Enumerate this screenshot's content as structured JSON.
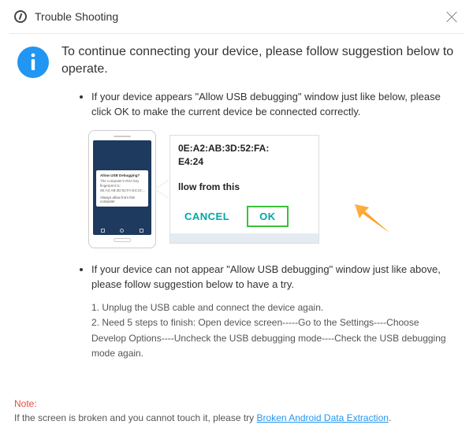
{
  "window": {
    "title": "Trouble Shooting"
  },
  "intro": "To continue connecting your device, please follow suggestion below to operate.",
  "bullet1": "If your device appears \"Allow USB debugging\" window just like below, please click OK to make the current device  be connected correctly.",
  "bullet2": "If your device can not appear \"Allow USB debugging\" window just like above, please follow suggestion below to have a try.",
  "steps": {
    "s1": "1. Unplug the USB cable and connect the device again.",
    "s2": "2. Need 5 steps to finish: Open device screen-----Go to the Settings----Choose Develop Options----Uncheck the USB debugging mode----Check the USB debugging mode again."
  },
  "phone_dialog": {
    "title": "Allow USB Debugging?",
    "body": "The computer's RSA key fingerprint is:\n0E:A2:AB:3D:52:FA:E4:24:...",
    "check": "Always allow from this computer"
  },
  "zoom": {
    "line1": "0E:A2:AB:3D:52:FA:",
    "line2": "E4:24",
    "line3": "llow from this",
    "cancel": "CANCEL",
    "ok": "OK"
  },
  "footer": {
    "note": "Note:",
    "text": "If the screen is broken and you cannot touch it, please try ",
    "link": "Broken Android Data Extraction",
    "dot": "."
  }
}
